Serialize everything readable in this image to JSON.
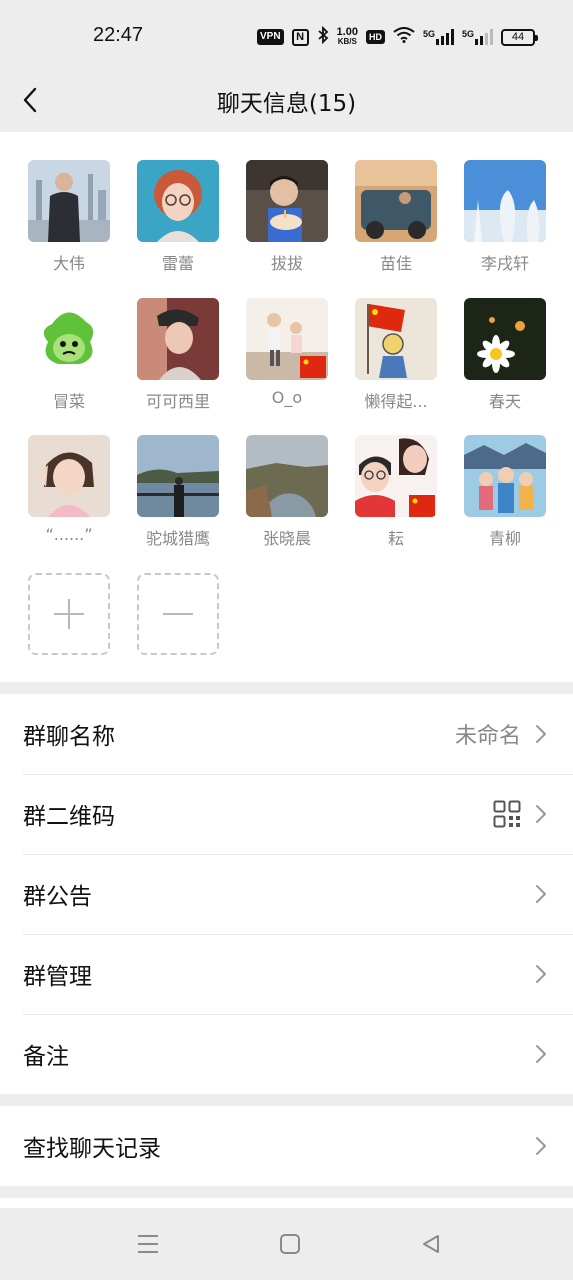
{
  "status_bar": {
    "time": "22:47",
    "vpn": "VPN",
    "nfc": "N",
    "speed_value": "1.00",
    "speed_unit": "KB/S",
    "hd": "HD",
    "signal_1": "5G",
    "signal_2": "5G",
    "battery": "44"
  },
  "header": {
    "title": "聊天信息(15)"
  },
  "members": [
    {
      "name": "大伟"
    },
    {
      "name": "雷蕾"
    },
    {
      "name": "拔拔"
    },
    {
      "name": "苗佳"
    },
    {
      "name": "李戌轩"
    },
    {
      "name": "冒菜"
    },
    {
      "name": "可可西里"
    },
    {
      "name": "O_o"
    },
    {
      "name": "懒得起..."
    },
    {
      "name": "春天"
    },
    {
      "name": "“......”"
    },
    {
      "name": "驼城猎鹰"
    },
    {
      "name": "张晓晨"
    },
    {
      "name": "耘"
    },
    {
      "name": "青柳"
    }
  ],
  "settings": {
    "group_name": {
      "label": "群聊名称",
      "value": "未命名"
    },
    "group_qr": {
      "label": "群二维码"
    },
    "group_notice": {
      "label": "群公告"
    },
    "group_manage": {
      "label": "群管理"
    },
    "remark": {
      "label": "备注"
    }
  },
  "search": {
    "label": "查找聊天记录"
  },
  "colors": {
    "background": "#ededed",
    "card": "#ffffff",
    "secondary_text": "#888888"
  }
}
